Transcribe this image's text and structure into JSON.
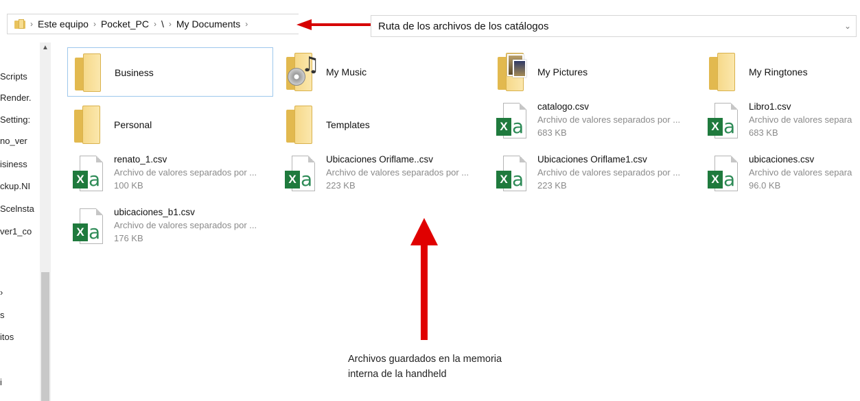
{
  "address_bar": {
    "breadcrumbs": [
      "Este equipo",
      "Pocket_PC",
      "\\",
      "My Documents"
    ],
    "separator": "›"
  },
  "path_field": {
    "text": "Ruta de los archivos de los catálogos",
    "chevron": "⌄"
  },
  "annotation": {
    "line1": "Archivos guardados en la memoria",
    "line2": "interna de la handheld"
  },
  "nav_pane": {
    "items": [
      "Scripts",
      "Render.",
      "Setting:",
      "no_ver",
      "isiness",
      "ckup.NI",
      "Scelnsta",
      "ver1_co",
      "›",
      "s",
      "itos",
      "i"
    ]
  },
  "folders": [
    {
      "name": "Business",
      "icon": "folder-icon",
      "selected": true
    },
    {
      "name": "My Music",
      "icon": "music-folder-icon"
    },
    {
      "name": "My Pictures",
      "icon": "pictures-folder-icon"
    },
    {
      "name": "My Ringtones",
      "icon": "folder-icon"
    },
    {
      "name": "Personal",
      "icon": "folder-icon"
    },
    {
      "name": "Templates",
      "icon": "folder-icon"
    }
  ],
  "files": [
    {
      "name": "catalogo.csv",
      "type": "Archivo de valores separados por ...",
      "size": "683 KB"
    },
    {
      "name": "Libro1.csv",
      "type": "Archivo de valores separa",
      "size": "683 KB"
    },
    {
      "name": "renato_1.csv",
      "type": "Archivo de valores separados por ...",
      "size": "100 KB"
    },
    {
      "name": "Ubicaciones Oriflame..csv",
      "type": "Archivo de valores separados por ...",
      "size": "223 KB"
    },
    {
      "name": "Ubicaciones Oriflame1.csv",
      "type": "Archivo de valores separados por ...",
      "size": "223 KB"
    },
    {
      "name": "ubicaciones.csv",
      "type": "Archivo de valores separa",
      "size": "96.0 KB"
    },
    {
      "name": "ubicaciones_b1.csv",
      "type": "Archivo de valores separados por ...",
      "size": "176 KB"
    }
  ],
  "colors": {
    "annotation_red": "#e00000",
    "excel_green": "#1f7a3d",
    "folder_yellow": "#f6d98a",
    "selection_border": "#9dc7ec"
  }
}
